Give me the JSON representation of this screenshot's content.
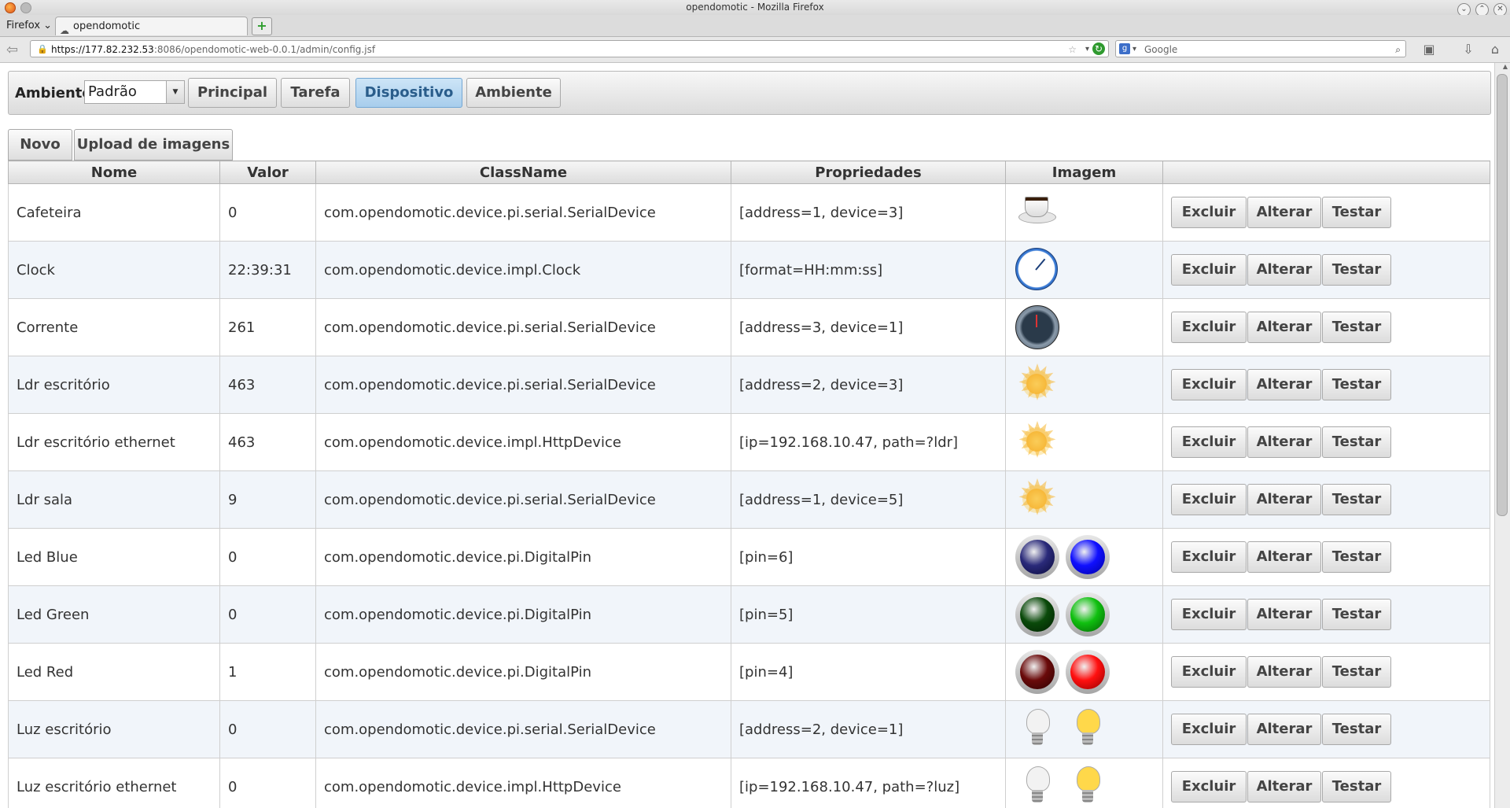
{
  "window": {
    "title": "opendomotic - Mozilla Firefox"
  },
  "browser": {
    "menu_label": "Firefox",
    "tab_title": "opendomotic",
    "url_host": "https://177.82.232.53",
    "url_rest": ":8086/opendomotic-web-0.0.1/admin/config.jsf",
    "search_placeholder": "Google"
  },
  "menubar": {
    "ambiente_label": "Ambiente",
    "ambiente_value": "Padrão",
    "buttons": [
      "Principal",
      "Tarefa",
      "Dispositivo",
      "Ambiente"
    ],
    "active": "Dispositivo"
  },
  "toolbar": {
    "novo": "Novo",
    "upload": "Upload de imagens"
  },
  "table": {
    "headers": [
      "Nome",
      "Valor",
      "ClassName",
      "Propriedades",
      "Imagem",
      ""
    ],
    "action_labels": {
      "excluir": "Excluir",
      "alterar": "Alterar",
      "testar": "Testar"
    },
    "rows": [
      {
        "nome": "Cafeteira",
        "valor": "0",
        "classname": "com.opendomotic.device.pi.serial.SerialDevice",
        "propriedades": "[address=1, device=3]",
        "images": [
          "coffee-cup-icon"
        ]
      },
      {
        "nome": "Clock",
        "valor": "22:39:31",
        "classname": "com.opendomotic.device.impl.Clock",
        "propriedades": "[format=HH:mm:ss]",
        "images": [
          "clock-icon"
        ]
      },
      {
        "nome": "Corrente",
        "valor": "261",
        "classname": "com.opendomotic.device.pi.serial.SerialDevice",
        "propriedades": "[address=3, device=1]",
        "images": [
          "gauge-icon"
        ]
      },
      {
        "nome": "Ldr escritório",
        "valor": "463",
        "classname": "com.opendomotic.device.pi.serial.SerialDevice",
        "propriedades": "[address=2, device=3]",
        "images": [
          "sun-icon"
        ]
      },
      {
        "nome": "Ldr escritório ethernet",
        "valor": "463",
        "classname": "com.opendomotic.device.impl.HttpDevice",
        "propriedades": "[ip=192.168.10.47, path=?ldr]",
        "images": [
          "sun-icon"
        ]
      },
      {
        "nome": "Ldr sala",
        "valor": "9",
        "classname": "com.opendomotic.device.pi.serial.SerialDevice",
        "propriedades": "[address=1, device=5]",
        "images": [
          "sun-icon"
        ]
      },
      {
        "nome": "Led Blue",
        "valor": "0",
        "classname": "com.opendomotic.device.pi.DigitalPin",
        "propriedades": "[pin=6]",
        "images": [
          "led-blue-off-icon",
          "led-blue-on-icon"
        ]
      },
      {
        "nome": "Led Green",
        "valor": "0",
        "classname": "com.opendomotic.device.pi.DigitalPin",
        "propriedades": "[pin=5]",
        "images": [
          "led-green-off-icon",
          "led-green-on-icon"
        ]
      },
      {
        "nome": "Led Red",
        "valor": "1",
        "classname": "com.opendomotic.device.pi.DigitalPin",
        "propriedades": "[pin=4]",
        "images": [
          "led-red-off-icon",
          "led-red-on-icon"
        ]
      },
      {
        "nome": "Luz escritório",
        "valor": "0",
        "classname": "com.opendomotic.device.pi.serial.SerialDevice",
        "propriedades": "[address=2, device=1]",
        "images": [
          "bulb-off-icon",
          "bulb-on-icon"
        ]
      },
      {
        "nome": "Luz escritório ethernet",
        "valor": "0",
        "classname": "com.opendomotic.device.impl.HttpDevice",
        "propriedades": "[ip=192.168.10.47, path=?luz]",
        "images": [
          "bulb-off-icon",
          "bulb-on-icon"
        ]
      }
    ]
  },
  "colors": {
    "active_button_bg": "#a7cdec",
    "row_alt_bg": "#f1f5fa",
    "led_blue": "#1010ff",
    "led_blue_off": "#2a2a7a",
    "led_green": "#10c010",
    "led_green_off": "#0a4a0a",
    "led_red": "#ff1010",
    "led_red_off": "#6a0a0a",
    "bulb_on": "#ffd84a",
    "bulb_off": "#f2f2f2"
  }
}
